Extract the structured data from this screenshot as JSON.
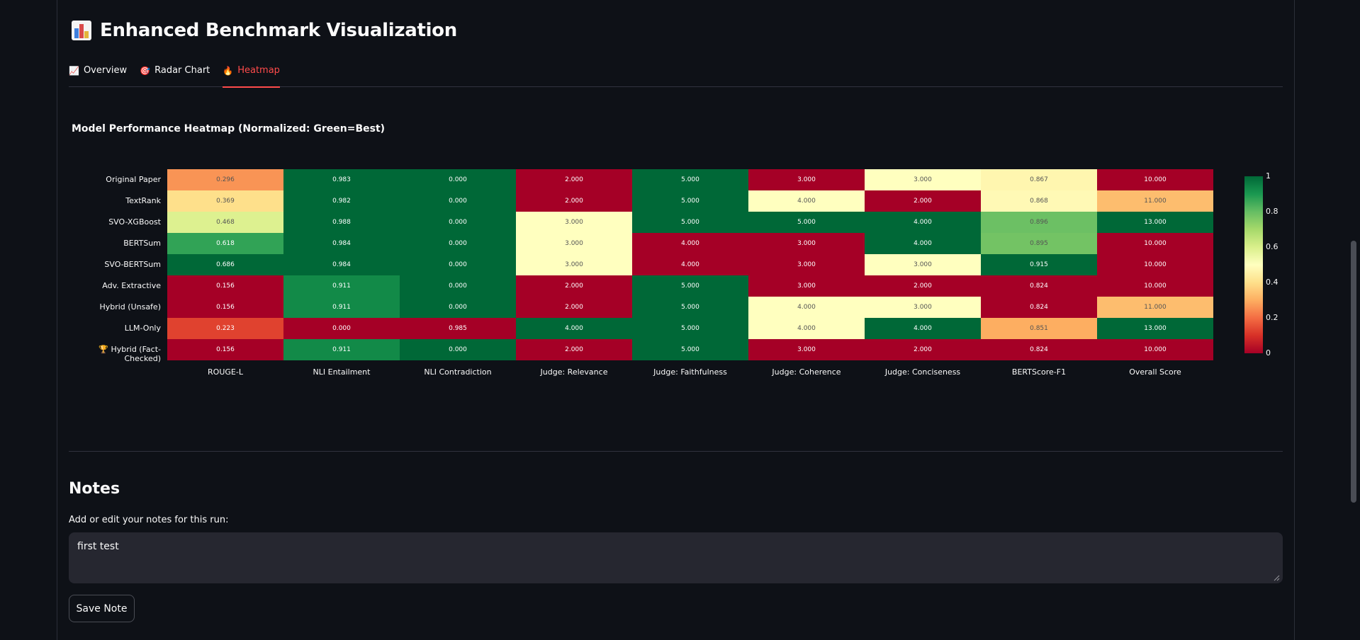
{
  "page": {
    "title": "Enhanced Benchmark Visualization",
    "title_icon": "bar-chart-icon"
  },
  "tabs": [
    {
      "label": "Overview",
      "icon": "chart-increasing-icon",
      "glyph": "📈",
      "active": false
    },
    {
      "label": "Radar Chart",
      "icon": "target-icon",
      "glyph": "🎯",
      "active": false
    },
    {
      "label": "Heatmap",
      "icon": "fire-icon",
      "glyph": "🔥",
      "active": true
    }
  ],
  "chart_data": {
    "type": "heatmap",
    "title": "Model Performance Heatmap (Normalized: Green=Best)",
    "rows": [
      "Original Paper",
      "TextRank",
      "SVO-XGBoost",
      "BERTSum",
      "SVO-BERTSum",
      "Adv. Extractive",
      "Hybrid (Unsafe)",
      "LLM-Only",
      "🏆 Hybrid (Fact-Checked)"
    ],
    "columns": [
      "ROUGE-L",
      "NLI Entailment",
      "NLI Contradiction",
      "Judge: Relevance",
      "Judge: Faithfulness",
      "Judge: Coherence",
      "Judge: Conciseness",
      "BERTScore-F1",
      "Overall Score"
    ],
    "values": [
      [
        "0.296",
        "0.983",
        "0.000",
        "2.000",
        "5.000",
        "3.000",
        "3.000",
        "0.867",
        "10.000"
      ],
      [
        "0.369",
        "0.982",
        "0.000",
        "2.000",
        "5.000",
        "4.000",
        "2.000",
        "0.868",
        "11.000"
      ],
      [
        "0.468",
        "0.988",
        "0.000",
        "3.000",
        "5.000",
        "5.000",
        "4.000",
        "0.896",
        "13.000"
      ],
      [
        "0.618",
        "0.984",
        "0.000",
        "3.000",
        "4.000",
        "3.000",
        "4.000",
        "0.895",
        "10.000"
      ],
      [
        "0.686",
        "0.984",
        "0.000",
        "3.000",
        "4.000",
        "3.000",
        "3.000",
        "0.915",
        "10.000"
      ],
      [
        "0.156",
        "0.911",
        "0.000",
        "2.000",
        "5.000",
        "3.000",
        "2.000",
        "0.824",
        "10.000"
      ],
      [
        "0.156",
        "0.911",
        "0.000",
        "2.000",
        "5.000",
        "4.000",
        "3.000",
        "0.824",
        "11.000"
      ],
      [
        "0.223",
        "0.000",
        "0.985",
        "4.000",
        "5.000",
        "4.000",
        "4.000",
        "0.851",
        "13.000"
      ],
      [
        "0.156",
        "0.911",
        "0.000",
        "2.000",
        "5.000",
        "3.000",
        "2.000",
        "0.824",
        "10.000"
      ]
    ],
    "normalized": [
      [
        0.26,
        1.0,
        1.0,
        0.0,
        1.0,
        0.0,
        0.5,
        0.47,
        0.0
      ],
      [
        0.4,
        1.0,
        1.0,
        0.0,
        1.0,
        0.5,
        0.0,
        0.48,
        0.33
      ],
      [
        0.59,
        1.0,
        1.0,
        0.5,
        1.0,
        1.0,
        1.0,
        0.79,
        1.0
      ],
      [
        0.87,
        1.0,
        1.0,
        0.5,
        0.0,
        0.0,
        1.0,
        0.78,
        0.0
      ],
      [
        1.0,
        1.0,
        1.0,
        0.5,
        0.0,
        0.0,
        0.5,
        1.0,
        0.0
      ],
      [
        0.0,
        0.93,
        1.0,
        0.0,
        1.0,
        0.0,
        0.0,
        0.0,
        0.0
      ],
      [
        0.0,
        0.93,
        1.0,
        0.0,
        1.0,
        0.5,
        0.5,
        0.0,
        0.33
      ],
      [
        0.13,
        0.0,
        0.0,
        1.0,
        1.0,
        0.5,
        1.0,
        0.3,
        1.0
      ],
      [
        0.0,
        0.93,
        1.0,
        0.0,
        1.0,
        0.0,
        0.0,
        0.0,
        0.0
      ]
    ],
    "colorscale": "RdYlGn",
    "colorbar": {
      "min": 0,
      "max": 1,
      "ticks": [
        "1",
        "0.8",
        "0.6",
        "0.4",
        "0.2",
        "0"
      ]
    }
  },
  "notes": {
    "heading": "Notes",
    "label": "Add or edit your notes for this run:",
    "value": "first test",
    "save_label": "Save Note"
  }
}
